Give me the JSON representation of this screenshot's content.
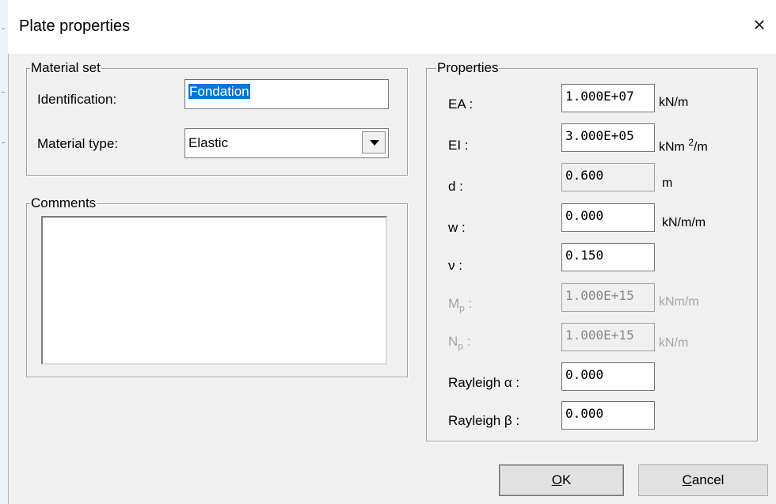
{
  "window": {
    "title": "Plate properties",
    "close_glyph": "×"
  },
  "material_set": {
    "legend": "Material set",
    "identification_label": "Identification:",
    "identification_value": "Fondation",
    "material_type_label": "Material type:",
    "material_type_value": "Elastic"
  },
  "comments": {
    "legend": "Comments",
    "value": ""
  },
  "properties": {
    "legend": "Properties",
    "rows": [
      {
        "label": "EA :",
        "value": "1.000E+07",
        "unit": "kN/m"
      },
      {
        "label": "EI :",
        "value": "3.000E+05",
        "unit_main": "kNm",
        "unit_sup": "2",
        "unit_tail": "/m"
      },
      {
        "label": "d :",
        "value": "0.600",
        "unit": "m"
      },
      {
        "label": "w :",
        "value": "0.000",
        "unit": "kN/m/m"
      },
      {
        "label": "ν :",
        "value": "0.150",
        "unit": ""
      },
      {
        "label_main": "M",
        "label_sub": "p",
        "label_tail": " :",
        "value": "1.000E+15",
        "unit": "kNm/m"
      },
      {
        "label_main": "N",
        "label_sub": "p",
        "label_tail": " :",
        "value": "1.000E+15",
        "unit": "kN/m"
      },
      {
        "label": "Rayleigh α :",
        "value": "0.000",
        "unit": ""
      },
      {
        "label": "Rayleigh β :",
        "value": "0.000",
        "unit": ""
      }
    ]
  },
  "buttons": {
    "ok_mnemonic": "O",
    "ok_rest": "K",
    "cancel_mnemonic": "C",
    "cancel_rest": "ancel"
  }
}
